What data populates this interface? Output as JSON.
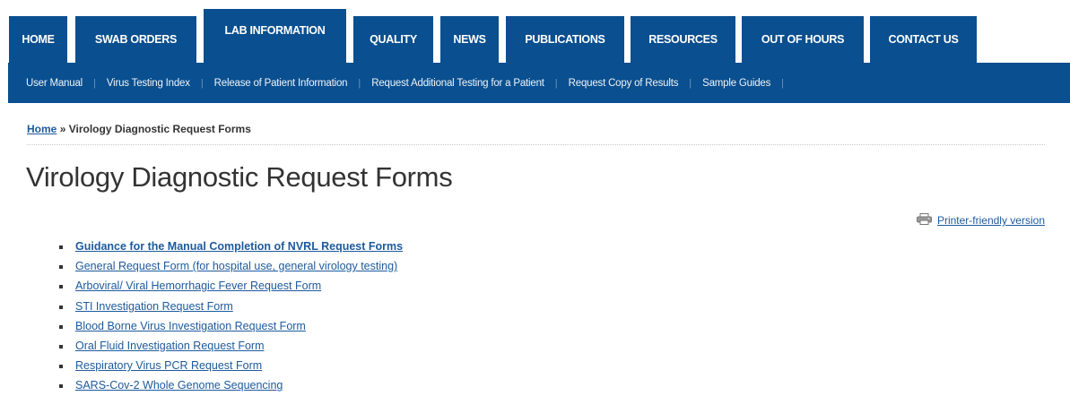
{
  "nav": {
    "tabs": [
      {
        "label": "HOME"
      },
      {
        "label": "SWAB ORDERS"
      },
      {
        "label": "LAB INFORMATION"
      },
      {
        "label": "QUALITY"
      },
      {
        "label": "NEWS"
      },
      {
        "label": "PUBLICATIONS"
      },
      {
        "label": "RESOURCES"
      },
      {
        "label": "OUT OF HOURS"
      },
      {
        "label": "CONTACT US"
      }
    ],
    "active_tab": "LAB INFORMATION"
  },
  "subnav": {
    "items": [
      {
        "label": "User Manual"
      },
      {
        "label": "Virus Testing Index"
      },
      {
        "label": "Release of Patient Information"
      },
      {
        "label": "Request Additional Testing for a Patient"
      },
      {
        "label": "Request Copy of Results"
      },
      {
        "label": "Sample Guides"
      }
    ]
  },
  "breadcrumb": {
    "home": "Home",
    "separator": "»",
    "current": "Virology Diagnostic Request Forms"
  },
  "page": {
    "title": "Virology Diagnostic Request Forms",
    "printer_label": "Printer-friendly version"
  },
  "forms": [
    {
      "label": "Guidance for the Manual Completion of NVRL Request Forms"
    },
    {
      "label": "General Request Form (for hospital use, general virology testing)"
    },
    {
      "label": "Arboviral/ Viral Hemorrhagic Fever Request Form"
    },
    {
      "label": "STI Investigation Request Form"
    },
    {
      "label": "Blood Borne Virus Investigation Request Form"
    },
    {
      "label": "Oral Fluid Investigation Request Form"
    },
    {
      "label": "Respiratory Virus PCR Request Form"
    },
    {
      "label": "SARS-Cov-2 Whole Genome Sequencing"
    }
  ],
  "icons": {
    "printer": "printer-icon"
  },
  "colors": {
    "nav_bg": "#0a4f8f",
    "link": "#1d5a9c"
  }
}
